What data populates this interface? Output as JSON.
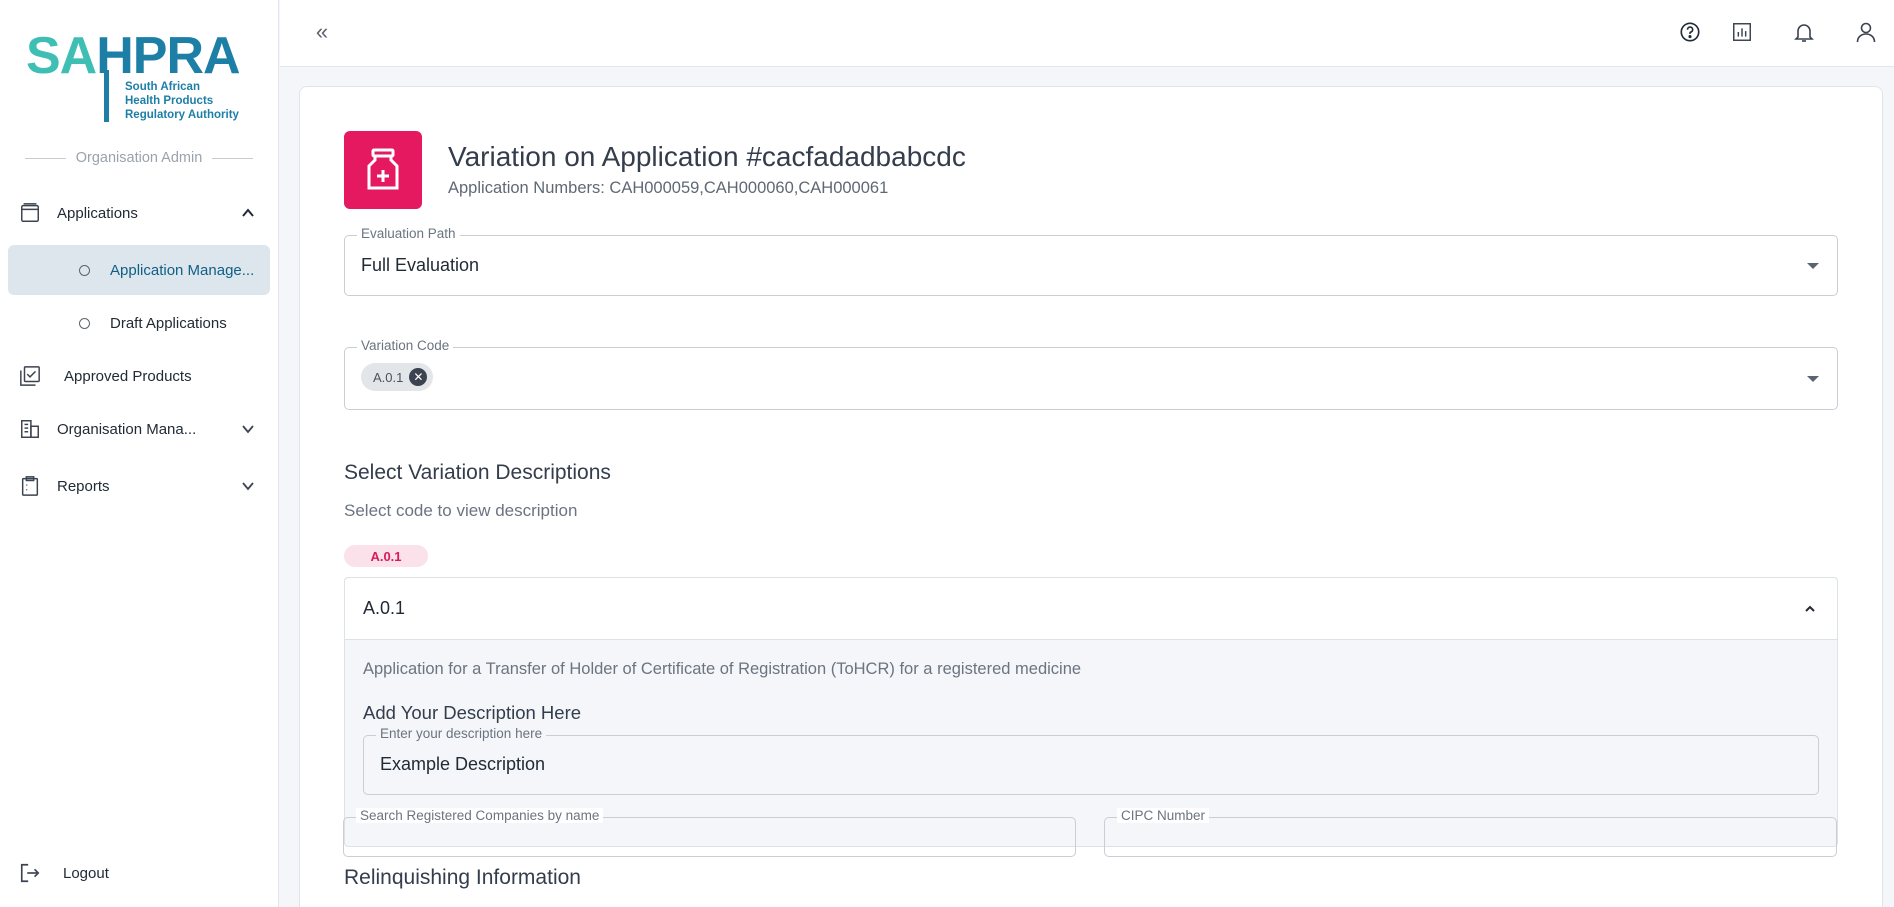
{
  "sidebar": {
    "logo": {
      "sa": "SA",
      "hpra": "HPRA",
      "line1": "South African",
      "line2": "Health Products",
      "line3": "Regulatory Authority"
    },
    "role": "Organisation Admin",
    "nav": {
      "applications": "Applications",
      "application_management": "Application Manage...",
      "draft_applications": "Draft Applications",
      "approved_products": "Approved Products",
      "organisation_management": "Organisation Mana...",
      "reports": "Reports",
      "logout": "Logout"
    }
  },
  "topbar": {
    "collapse_glyph": "«",
    "icons": [
      "help-icon",
      "analytics-icon",
      "notification-bell-icon",
      "user-profile-icon"
    ]
  },
  "main": {
    "title": "Variation on Application #cacfadadbabcdc",
    "subtitle": "Application Numbers: CAH000059,CAH000060,CAH000061",
    "evaluation_path": {
      "label": "Evaluation Path",
      "value": "Full Evaluation"
    },
    "variation_code": {
      "label": "Variation Code",
      "chips": [
        "A.0.1"
      ]
    },
    "select_descriptions": {
      "title": "Select Variation Descriptions",
      "hint": "Select code to view description",
      "badge": "A.0.1"
    },
    "accordion": {
      "code": "A.0.1",
      "description": "Application for a Transfer of Holder of Certificate of Registration (ToHCR) for a registered medicine",
      "add_title": "Add Your Description Here",
      "input_label": "Enter your description here",
      "input_value": "Example Description"
    },
    "relinquishing": {
      "title": "Relinquishing Information",
      "search_label": "Search Registered Companies by name",
      "cipc_label": "CIPC Number"
    }
  },
  "colors": {
    "brand_teal": "#3fbfb3",
    "brand_blue": "#1d7fa6",
    "accent_pink": "#e5195f"
  }
}
